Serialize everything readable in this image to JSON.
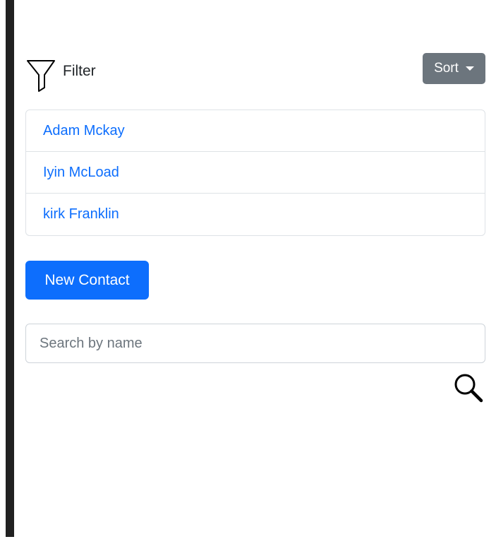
{
  "filter": {
    "label": "Filter",
    "icon": "filter-funnel-icon"
  },
  "sort": {
    "label": "Sort",
    "icon": "caret-down-icon"
  },
  "contacts": [
    {
      "name": "Adam Mckay"
    },
    {
      "name": "Iyin McLoad"
    },
    {
      "name": "kirk Franklin"
    }
  ],
  "new_contact": {
    "label": "New Contact"
  },
  "search": {
    "placeholder": "Search by name",
    "value": "",
    "icon": "magnifier-icon"
  },
  "colors": {
    "primary": "#0d6efd",
    "secondary": "#6c757d",
    "sidebar_bar": "#212121",
    "border": "#dee2e6"
  }
}
